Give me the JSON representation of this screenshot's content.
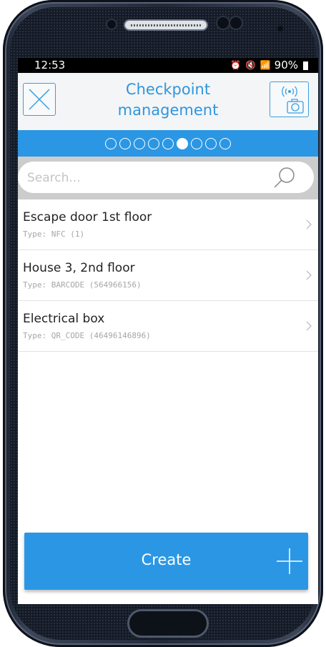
{
  "status_bar": {
    "time": "12:53",
    "icons": "⏰ 🔇 📶",
    "battery": "90%"
  },
  "header": {
    "title_line1": "Checkpoint",
    "title_line2": "management",
    "close_icon": "close-icon",
    "camera_icon": "nfc-camera-icon"
  },
  "steps": {
    "total": 9,
    "active_index": 5
  },
  "search": {
    "placeholder": "Search...",
    "value": ""
  },
  "checkpoints": [
    {
      "name": "Escape door 1st floor",
      "type": "Type: NFC (1)"
    },
    {
      "name": "House 3, 2nd floor",
      "type": "Type: BARCODE (564966156)"
    },
    {
      "name": "Electrical box",
      "type": "Type: QR_CODE (46496146896)"
    }
  ],
  "create_button": {
    "label": "Create"
  },
  "colors": {
    "accent": "#2b97e4",
    "header_bg": "#f4f5f6",
    "search_bar_bg": "#cccccc"
  }
}
